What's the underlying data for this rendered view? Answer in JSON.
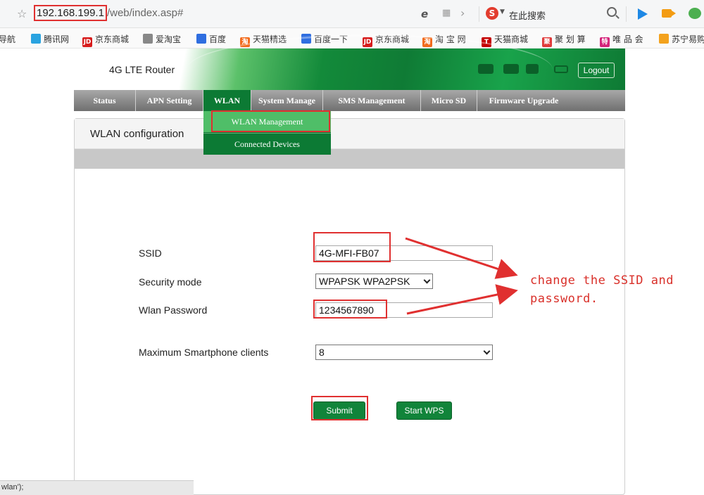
{
  "browser": {
    "url_host": "192.168.199.1",
    "url_path": "/web/index.asp#",
    "search_placeholder": "在此搜索",
    "ie_icon": "e",
    "grid_icon": "grid-icon",
    "search_logo": "S"
  },
  "bookmarks": [
    {
      "label": "导航",
      "icon": "",
      "color": ""
    },
    {
      "label": "腾讯网",
      "icon": "",
      "color": "#2aa3e0"
    },
    {
      "label": "京东商城",
      "icon": "JD",
      "color": "#d71c1c"
    },
    {
      "label": "爱淘宝",
      "icon": "",
      "color": "#888888"
    },
    {
      "label": "百度",
      "icon": "",
      "color": "#2f6ee0"
    },
    {
      "label": "天猫精选",
      "icon": "淘",
      "color": "#f26b1d"
    },
    {
      "label": "百度一下",
      "icon": "",
      "color": "#2f6ee0"
    },
    {
      "label": "京东商城",
      "icon": "JD",
      "color": "#d71c1c"
    },
    {
      "label": "淘 宝 网",
      "icon": "淘",
      "color": "#f26b1d"
    },
    {
      "label": "天猫商城",
      "icon": "T",
      "color": "#c40000"
    },
    {
      "label": "聚 划 算",
      "icon": "聚",
      "color": "#e03a3a"
    },
    {
      "label": "唯 品 会",
      "icon": "特",
      "color": "#d4237a"
    },
    {
      "label": "苏宁易购",
      "icon": "",
      "color": "#f3a21d"
    }
  ],
  "router": {
    "title": "4G LTE Router",
    "logout": "Logout"
  },
  "nav": {
    "items": [
      "Status",
      "APN Setting",
      "WLAN",
      "System Manage",
      "SMS Management",
      "Micro SD",
      "Firmware Upgrade"
    ],
    "active": "WLAN"
  },
  "dropdown": {
    "items": [
      "WLAN Management",
      "Connected Devices"
    ]
  },
  "panel": {
    "title": "WLAN configuration"
  },
  "form": {
    "ssid_label": "SSID",
    "ssid_value": "4G-MFI-FB07",
    "security_label": "Security mode",
    "security_value": "WPAPSK WPA2PSK",
    "password_label": "Wlan Password",
    "password_value": "1234567890",
    "max_clients_label": "Maximum Smartphone clients",
    "max_clients_value": "8",
    "submit_label": "Submit",
    "wps_label": "Start WPS"
  },
  "annotation": {
    "line1": "change the SSID and",
    "line2": "password."
  },
  "statusbar": {
    "text": "wlan');"
  },
  "colors": {
    "accent_green": "#11843a",
    "highlight_red": "#e03030",
    "annotation_red": "#d9302a"
  }
}
